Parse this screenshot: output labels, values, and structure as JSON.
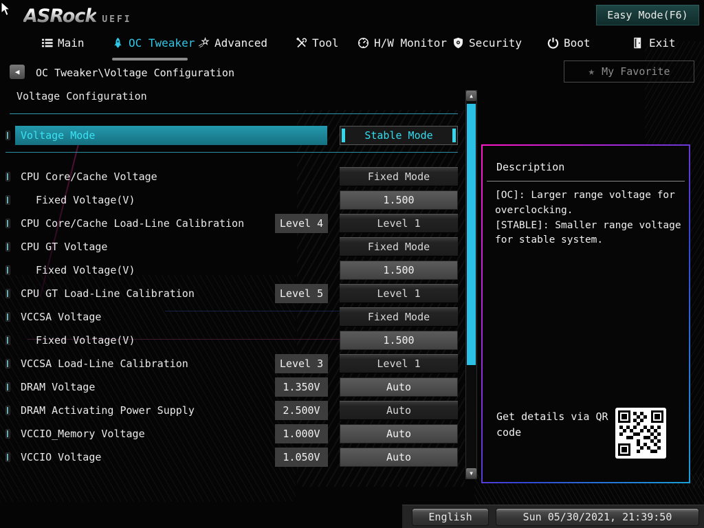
{
  "brand": {
    "name": "ASRock",
    "suffix": "UEFI"
  },
  "header": {
    "easy_mode_label": "Easy Mode(F6)"
  },
  "nav": {
    "tabs": [
      {
        "label": "Main",
        "icon": "list-icon",
        "active": false
      },
      {
        "label": "OC Tweaker",
        "icon": "rocket-icon",
        "active": true
      },
      {
        "label": "Advanced",
        "icon": "shooting-star-icon",
        "active": false
      },
      {
        "label": "Tool",
        "icon": "tools-icon",
        "active": false
      },
      {
        "label": "H/W Monitor",
        "icon": "gauge-icon",
        "active": false
      },
      {
        "label": "Security",
        "icon": "shield-icon",
        "active": false
      },
      {
        "label": "Boot",
        "icon": "power-icon",
        "active": false
      },
      {
        "label": "Exit",
        "icon": "exit-door-icon",
        "active": false
      }
    ]
  },
  "breadcrumb": {
    "path": "OC Tweaker\\Voltage Configuration"
  },
  "favorites": {
    "label": "My Favorite"
  },
  "page": {
    "title": "Voltage Configuration"
  },
  "rows": [
    {
      "label": "Voltage Mode",
      "value": "Stable Mode",
      "style": "selected",
      "selected": true
    },
    {
      "label": "CPU Core/Cache Voltage",
      "value": "Fixed Mode",
      "style": "button"
    },
    {
      "label": "Fixed Voltage(V)",
      "value": "1.500",
      "style": "input",
      "indent": true
    },
    {
      "label": "CPU Core/Cache Load-Line Calibration",
      "badge": "Level 4",
      "value": "Level 1",
      "style": "button"
    },
    {
      "label": "CPU GT Voltage",
      "value": "Fixed Mode",
      "style": "button"
    },
    {
      "label": "Fixed Voltage(V)",
      "value": "1.500",
      "style": "input",
      "indent": true
    },
    {
      "label": "CPU GT Load-Line Calibration",
      "badge": "Level 5",
      "value": "Level 1",
      "style": "button"
    },
    {
      "label": "VCCSA Voltage",
      "value": "Fixed Mode",
      "style": "button"
    },
    {
      "label": "Fixed Voltage(V)",
      "value": "1.500",
      "style": "input",
      "indent": true
    },
    {
      "label": "VCCSA Load-Line Calibration",
      "badge": "Level 3",
      "value": "Level 1",
      "style": "button"
    },
    {
      "label": "DRAM Voltage",
      "badge": "1.350V",
      "value": "Auto",
      "style": "input"
    },
    {
      "label": "DRAM Activating Power Supply",
      "badge": "2.500V",
      "value": "Auto",
      "style": "button"
    },
    {
      "label": "VCCIO_Memory Voltage",
      "badge": "1.000V",
      "value": "Auto",
      "style": "input"
    },
    {
      "label": "VCCIO Voltage",
      "badge": "1.050V",
      "value": "Auto",
      "style": "input"
    }
  ],
  "description_panel": {
    "title": "Description",
    "body": "[OC]: Larger range voltage for overclocking.\n[STABLE]: Smaller range voltage for stable system.",
    "qr_label": "Get details via QR code"
  },
  "statusbar": {
    "language": "English",
    "datetime": "Sun 05/30/2021, 21:39:50"
  },
  "icons": {
    "back": "◀",
    "favorite_star": "★",
    "scroll_up": "▲",
    "scroll_down": "▼"
  },
  "colors": {
    "accent_cyan": "#30c8e8",
    "highlight_teal": "#1b8ea4",
    "selected_value_cyan": "#35dcf0",
    "divider_cyan": "#2f97ad",
    "panel_border_magenta": "#ff17c8",
    "panel_border_blue": "#3346d6",
    "scroll_thumb": "#2cc0e4"
  }
}
